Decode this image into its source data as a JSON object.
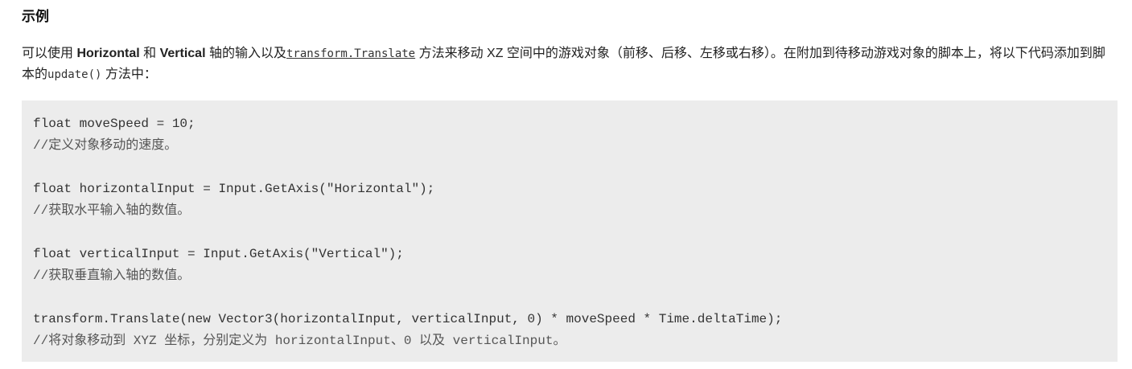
{
  "section": {
    "title": "示例"
  },
  "intro": {
    "part1": "可以使用 ",
    "horizontal": "Horizontal",
    "part2": " 和 ",
    "vertical": "Vertical",
    "part3": " 轴的输入以及",
    "translate_link": "transform.Translate",
    "part4": " 方法来移动 XZ 空间中的游戏对象（前移、后移、左移或右移）。在附加到待移动游戏对象的脚本上，将以下代码添加到脚本的",
    "update_code": "update()",
    "part5": " 方法中："
  },
  "code": {
    "lines": [
      "float moveSpeed = 10;",
      "//定义对象移动的速度。",
      "",
      "float horizontalInput = Input.GetAxis(\"Horizontal\");",
      "//获取水平输入轴的数值。",
      "",
      "float verticalInput = Input.GetAxis(\"Vertical\");",
      "//获取垂直输入轴的数值。",
      "",
      "transform.Translate(new Vector3(horizontalInput, verticalInput, 0) * moveSpeed * Time.deltaTime);",
      "//将对象移动到 XYZ 坐标，分别定义为 horizontalInput、0 以及 verticalInput。"
    ]
  },
  "colors": {
    "code_background": "#ececec",
    "text": "#222222"
  }
}
